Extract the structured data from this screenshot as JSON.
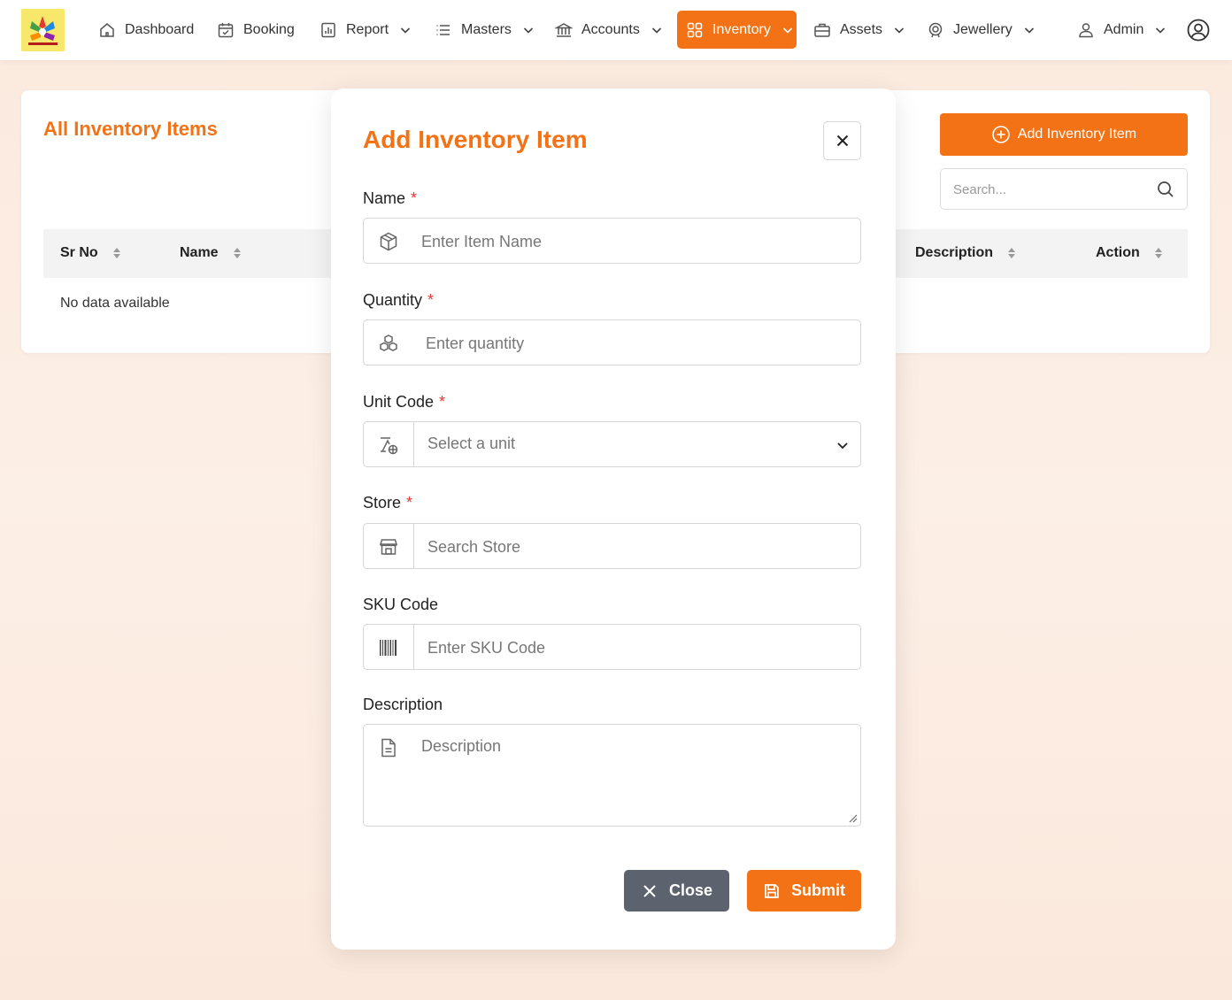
{
  "nav": {
    "items": [
      {
        "label": "Dashboard",
        "icon": "home-icon"
      },
      {
        "label": "Booking",
        "icon": "calendar-icon"
      },
      {
        "label": "Report",
        "icon": "report-icon"
      },
      {
        "label": "Masters",
        "icon": "list-icon"
      },
      {
        "label": "Accounts",
        "icon": "bank-icon"
      },
      {
        "label": "Inventory",
        "icon": "grid-icon",
        "active": true
      },
      {
        "label": "Assets",
        "icon": "briefcase-icon"
      },
      {
        "label": "Jewellery",
        "icon": "gem-icon"
      }
    ],
    "user_label": "Admin",
    "accent_color": "#f47216"
  },
  "page": {
    "title": "All Inventory Items",
    "add_button_label": "Add Inventory Item",
    "search_placeholder": "Search...",
    "table": {
      "columns": [
        "Sr No",
        "Name",
        "Description",
        "Action"
      ],
      "empty_text": "No data available"
    }
  },
  "modal": {
    "title": "Add Inventory Item",
    "fields": {
      "name": {
        "label": "Name",
        "required": "*",
        "placeholder": "Enter Item Name"
      },
      "quantity": {
        "label": "Quantity",
        "required": "*",
        "placeholder": "Enter quantity"
      },
      "unit_code": {
        "label": "Unit Code",
        "required": "*",
        "selected": "Select a unit"
      },
      "store": {
        "label": "Store",
        "required": "*",
        "placeholder": "Search Store"
      },
      "sku_code": {
        "label": "SKU Code",
        "placeholder": "Enter SKU Code"
      },
      "description": {
        "label": "Description",
        "placeholder": "Description"
      }
    },
    "close_label": "Close",
    "submit_label": "Submit"
  }
}
